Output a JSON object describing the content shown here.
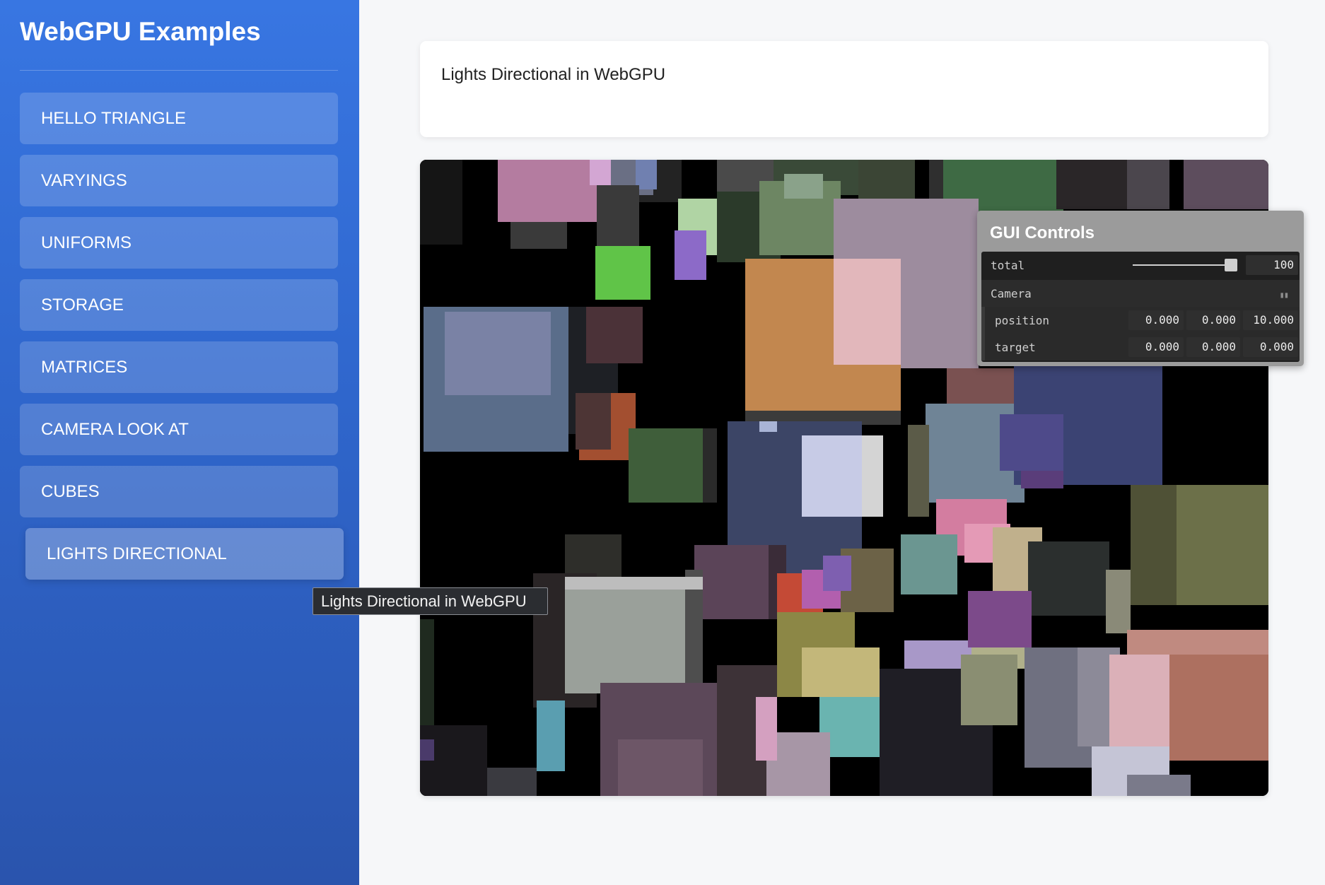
{
  "sidebar": {
    "title": "WebGPU Examples",
    "items": [
      {
        "label": "HELLO TRIANGLE"
      },
      {
        "label": "VARYINGS"
      },
      {
        "label": "UNIFORMS"
      },
      {
        "label": "STORAGE"
      },
      {
        "label": "MATRICES"
      },
      {
        "label": "CAMERA LOOK AT"
      },
      {
        "label": "CUBES"
      },
      {
        "label": "LIGHTS DIRECTIONAL"
      }
    ],
    "active_index": 7
  },
  "tooltip": {
    "text": "Lights Directional in WebGPU"
  },
  "main": {
    "description": "Lights Directional in WebGPU"
  },
  "gui": {
    "title": "GUI Controls",
    "total": {
      "label": "total",
      "value": "100",
      "level": 1.0
    },
    "camera": {
      "label": "Camera",
      "collapse_icon": "collapse-icon",
      "position": {
        "label": "position",
        "x": "0.000",
        "y": "0.000",
        "z": "10.000"
      },
      "target": {
        "label": "target",
        "x": "0.000",
        "y": "0.000",
        "z": "0.000"
      }
    }
  },
  "colors": {
    "sidebar_top": "#3876e2",
    "sidebar_bottom": "#2a54ad",
    "page_bg": "#f6f7f9",
    "canvas_bg": "#000000",
    "gui_panel": "#9b9b9b",
    "gui_body": "#1f1f1f"
  }
}
